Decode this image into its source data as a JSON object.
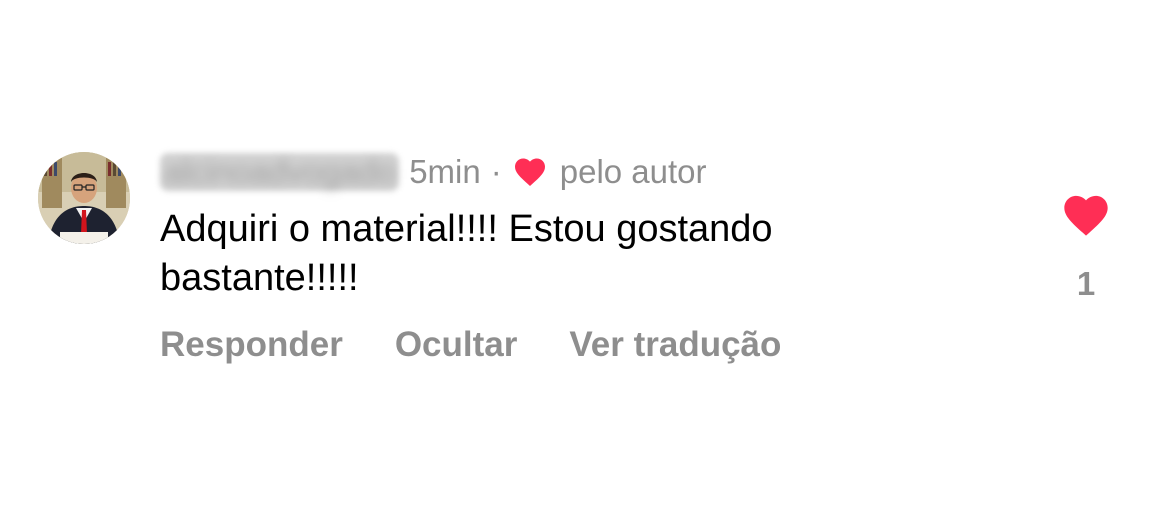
{
  "comment": {
    "username": "alcinoadvogado",
    "timestamp": "5min",
    "separator": "·",
    "liked_by_author_label": "pelo autor",
    "text": "Adquiri o material!!!! Estou gostando bastante!!!!!",
    "like_count": "1",
    "heart_color": "#ff2e55"
  },
  "actions": {
    "reply": "Responder",
    "hide": "Ocultar",
    "translate": "Ver tradução"
  }
}
